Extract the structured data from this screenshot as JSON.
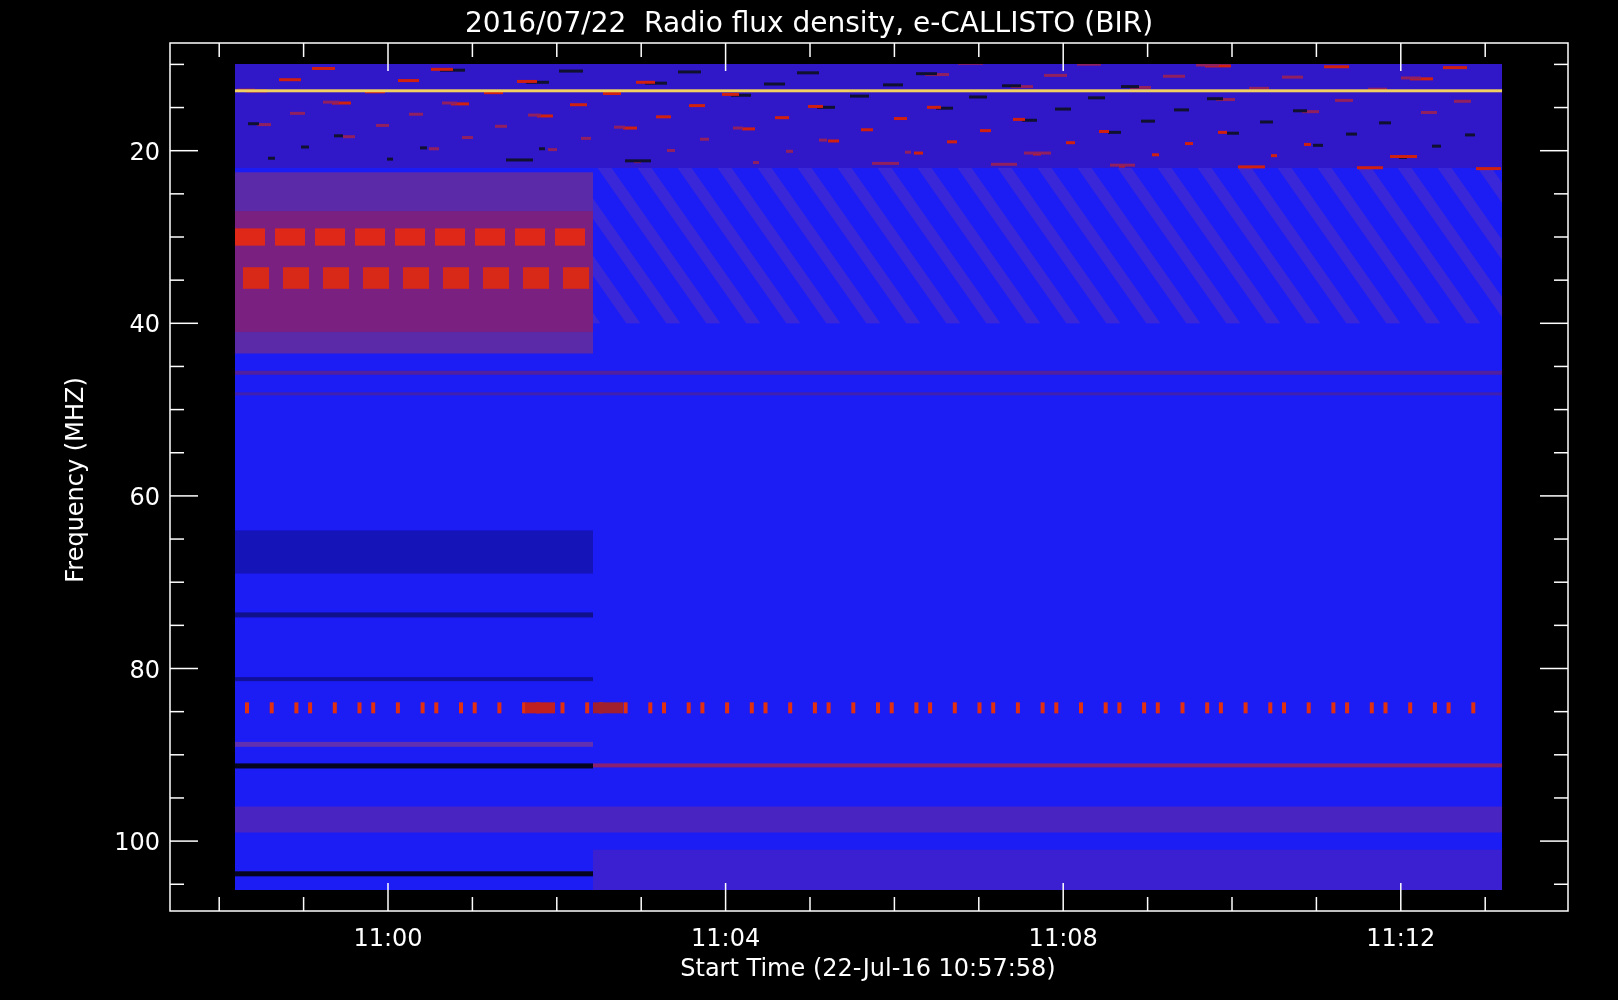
{
  "title": "2016/07/22  Radio flux density, e-CALLISTO (BIR)",
  "y_axis": {
    "label": "Frequency (MHZ)",
    "ticks": [
      "20",
      "40",
      "60",
      "80",
      "100"
    ]
  },
  "x_axis": {
    "label": "Start Time (22-Jul-16 10:57:58)",
    "ticks": [
      "11:00",
      "11:04",
      "11:08",
      "11:12"
    ]
  }
}
